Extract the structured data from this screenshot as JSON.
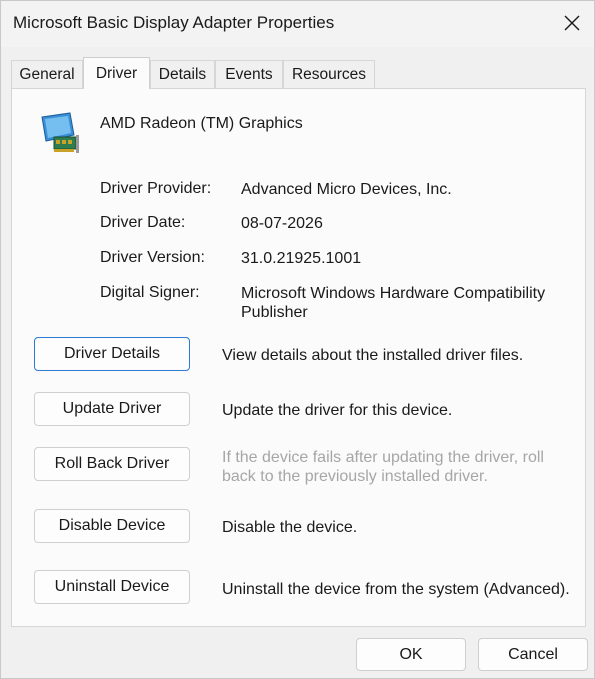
{
  "window": {
    "title": "Microsoft Basic Display Adapter Properties",
    "close_icon": "close-icon"
  },
  "tabs": [
    {
      "label": "General",
      "active": false
    },
    {
      "label": "Driver",
      "active": true
    },
    {
      "label": "Details",
      "active": false
    },
    {
      "label": "Events",
      "active": false
    },
    {
      "label": "Resources",
      "active": false
    }
  ],
  "device": {
    "icon": "display-adapter-icon",
    "name": "AMD Radeon (TM) Graphics"
  },
  "properties": [
    {
      "label": "Driver Provider:",
      "value": "Advanced Micro Devices, Inc."
    },
    {
      "label": "Driver Date:",
      "value": "08-07-2026"
    },
    {
      "label": "Driver Version:",
      "value": "31.0.21925.1001"
    },
    {
      "label": "Digital Signer:",
      "value": "Microsoft Windows Hardware Compatibility Publisher"
    }
  ],
  "actions": [
    {
      "label": "Driver Details",
      "description": "View details about the installed driver files.",
      "enabled": true
    },
    {
      "label": "Update Driver",
      "description": "Update the driver for this device.",
      "enabled": true
    },
    {
      "label": "Roll Back Driver",
      "description": "If the device fails after updating the driver, roll back to the previously installed driver.",
      "enabled": false
    },
    {
      "label": "Disable Device",
      "description": "Disable the device.",
      "enabled": true
    },
    {
      "label": "Uninstall Device",
      "description": "Uninstall the device from the system (Advanced).",
      "enabled": true
    }
  ],
  "footer": {
    "ok_label": "OK",
    "cancel_label": "Cancel"
  },
  "colors": {
    "focus_border": "#2b7bd4",
    "disabled_text": "#a6a6a6"
  }
}
